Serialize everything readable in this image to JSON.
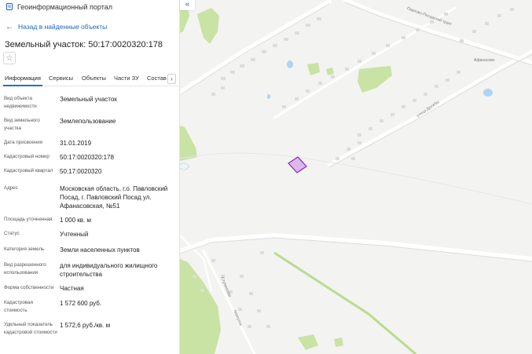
{
  "header": {
    "portal_name": "Геоинформационный портал"
  },
  "back_link": "Назад в найденные объекты",
  "title": "Земельный участок: 50:17:0020320:178",
  "tabs": [
    {
      "label": "Информация",
      "active": true
    },
    {
      "label": "Сервисы"
    },
    {
      "label": "Объекты"
    },
    {
      "label": "Части ЗУ"
    },
    {
      "label": "Состав"
    }
  ],
  "details": [
    {
      "label": "Вид объекта недвижимости",
      "value": "Земельный участок"
    },
    {
      "label": "Вид земельного участка",
      "value": "Землепользование"
    },
    {
      "label": "Дата присвоения",
      "value": "31.01.2019"
    },
    {
      "label": "Кадастровый номер",
      "value": "50:17:0020320:178"
    },
    {
      "label": "Кадастровый квартал",
      "value": "50:17:0020320"
    },
    {
      "label": "Адрес",
      "value": "Московская область, г.о. Павловский Посад, г. Павловский Посад ул. Афанасовская, №51"
    },
    {
      "label": "Площадь уточненная",
      "value": "1 000 кв. м"
    },
    {
      "label": "Статус",
      "value": "Учтенный"
    },
    {
      "label": "Категория земель",
      "value": "Земли населенных пунктов"
    },
    {
      "label": "Вид разрешенного использования",
      "value": "для индивидуального жилищного строительства"
    },
    {
      "label": "Форма собственности",
      "value": "Частная"
    },
    {
      "label": "Кадастровая стоимость",
      "value": "1 572 600 руб."
    },
    {
      "label": "Удельный показатель кадастровой стоимости",
      "value": "1 572,6 руб./кв. м"
    }
  ],
  "map": {
    "streets": {
      "pavlovo_posadsky": "Павлово-Посадский тракт",
      "afanasovo": "Афанасово",
      "druzhby": "улица Дружбы",
      "stupinskaya": "Ступинская",
      "pereulok": "переулок"
    },
    "colors": {
      "parcel_fill": "#dcb8f0",
      "parcel_stroke": "#8b2a9b",
      "forest": "#c8e3a3",
      "water": "#aed4f5",
      "accent": "#1a65c1"
    }
  }
}
